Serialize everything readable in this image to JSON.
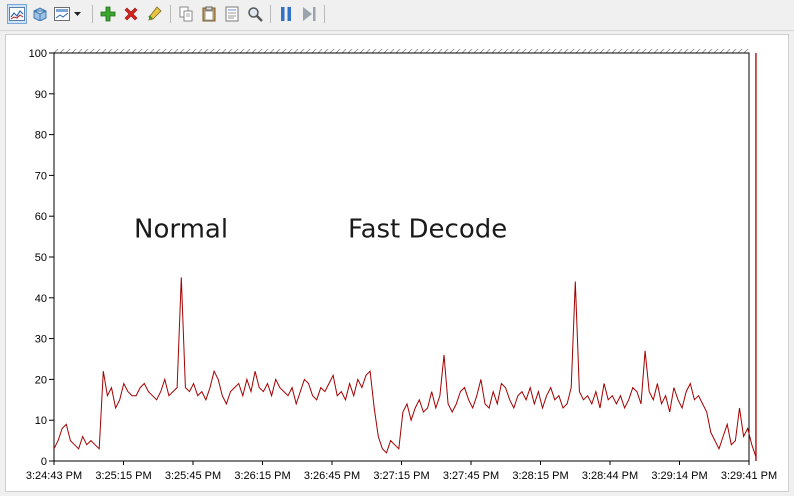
{
  "toolbar": {
    "buttons": [
      {
        "name": "view-graph-icon",
        "active": true
      },
      {
        "name": "view-histogram-icon"
      },
      {
        "name": "change-graph-type-icon",
        "dropdown": true
      },
      {
        "name": "add-counter-icon"
      },
      {
        "name": "delete-counter-icon"
      },
      {
        "name": "highlight-icon"
      },
      {
        "name": "copy-properties-icon"
      },
      {
        "name": "paste-counter-list-icon"
      },
      {
        "name": "properties-icon"
      },
      {
        "name": "zoom-icon"
      },
      {
        "name": "freeze-display-icon"
      },
      {
        "name": "update-data-icon"
      }
    ]
  },
  "chart_data": {
    "type": "line",
    "ylim": [
      0,
      100
    ],
    "yticks": [
      0,
      10,
      20,
      30,
      40,
      50,
      60,
      70,
      80,
      90,
      100
    ],
    "xtick_labels": [
      "3:24:43 PM",
      "3:25:15 PM",
      "3:25:45 PM",
      "3:26:15 PM",
      "3:26:45 PM",
      "3:27:15 PM",
      "3:27:45 PM",
      "3:28:15 PM",
      "3:28:44 PM",
      "3:29:14 PM",
      "3:29:41 PM"
    ],
    "annotations": [
      {
        "text": "Normal",
        "x_index": 23,
        "y": 57
      },
      {
        "text": "Fast Decode",
        "x_index": 68,
        "y": 57
      }
    ],
    "current_position_index": 101,
    "series": [
      {
        "color": "#a30000",
        "values": [
          3,
          5,
          8,
          9,
          5,
          4,
          3,
          6,
          4,
          5,
          4,
          3,
          22,
          16,
          18,
          13,
          15,
          19,
          17,
          16,
          16,
          18,
          19,
          17,
          16,
          15,
          17,
          20,
          16,
          17,
          18,
          45,
          18,
          17,
          19,
          16,
          17,
          15,
          18,
          22,
          20,
          16,
          14,
          17,
          18,
          19,
          16,
          20,
          17,
          22,
          18,
          17,
          19,
          16,
          20,
          18,
          17,
          16,
          18,
          14,
          17,
          20,
          19,
          16,
          15,
          18,
          17,
          19,
          21,
          16,
          17,
          15,
          19,
          16,
          20,
          18,
          21,
          22,
          13,
          6,
          3,
          2,
          5,
          4,
          3,
          12,
          14,
          10,
          13,
          15,
          12,
          13,
          17,
          13,
          16,
          26,
          14,
          12,
          14,
          17,
          18,
          15,
          13,
          16,
          20,
          14,
          13,
          17,
          14,
          19,
          18,
          15,
          13,
          16,
          17,
          15,
          18,
          14,
          17,
          13,
          16,
          18,
          15,
          16,
          13,
          14,
          18,
          44,
          17,
          15,
          16,
          14,
          17,
          13,
          19,
          15,
          16,
          14,
          16,
          13,
          15,
          18,
          17,
          14,
          27,
          17,
          15,
          19,
          14,
          16,
          12,
          18,
          15,
          13,
          17,
          19,
          15,
          16,
          14,
          12,
          7,
          5,
          3,
          6,
          9,
          4,
          5,
          13,
          6,
          8,
          4,
          1
        ]
      }
    ]
  }
}
